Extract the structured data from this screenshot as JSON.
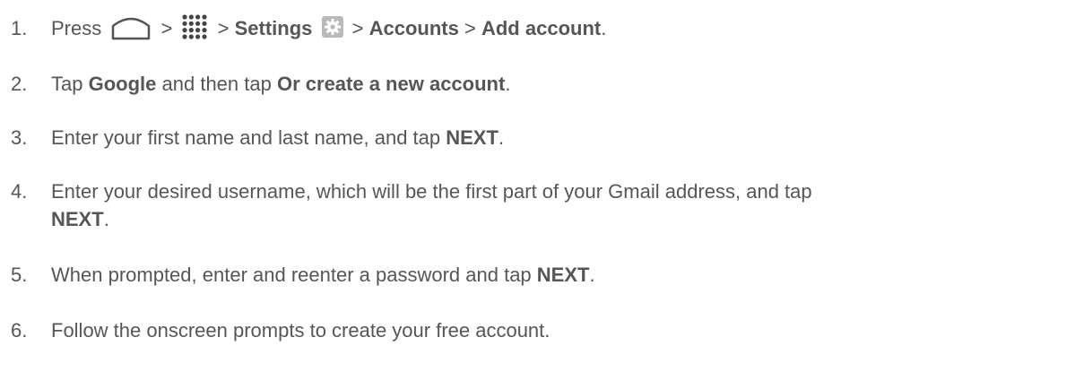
{
  "steps": [
    {
      "number": "1.",
      "press": "Press",
      "sep1": ">",
      "sep2": ">",
      "settings": "Settings",
      "sep3": ">",
      "accounts": "Accounts",
      "sep4": ">",
      "add_account": "Add account",
      "end": ".",
      "icons": [
        "home-icon",
        "apps-icon",
        "settings-gear-icon"
      ]
    },
    {
      "number": "2.",
      "t1": "Tap",
      "google": "Google",
      "t2": "and then tap",
      "create": "Or create a new account",
      "end": "."
    },
    {
      "number": "3.",
      "t1": "Enter your first name and last name, and tap",
      "next": "NEXT",
      "end": "."
    },
    {
      "number": "4.",
      "t1": "Enter your desired username, which will be the first part of your Gmail address, and tap",
      "next": "NEXT",
      "end": "."
    },
    {
      "number": "5.",
      "t1": "When prompted, enter and reenter a password and tap",
      "next": "NEXT",
      "end": "."
    },
    {
      "number": "6.",
      "t1": "Follow the onscreen prompts to create your free account."
    }
  ]
}
